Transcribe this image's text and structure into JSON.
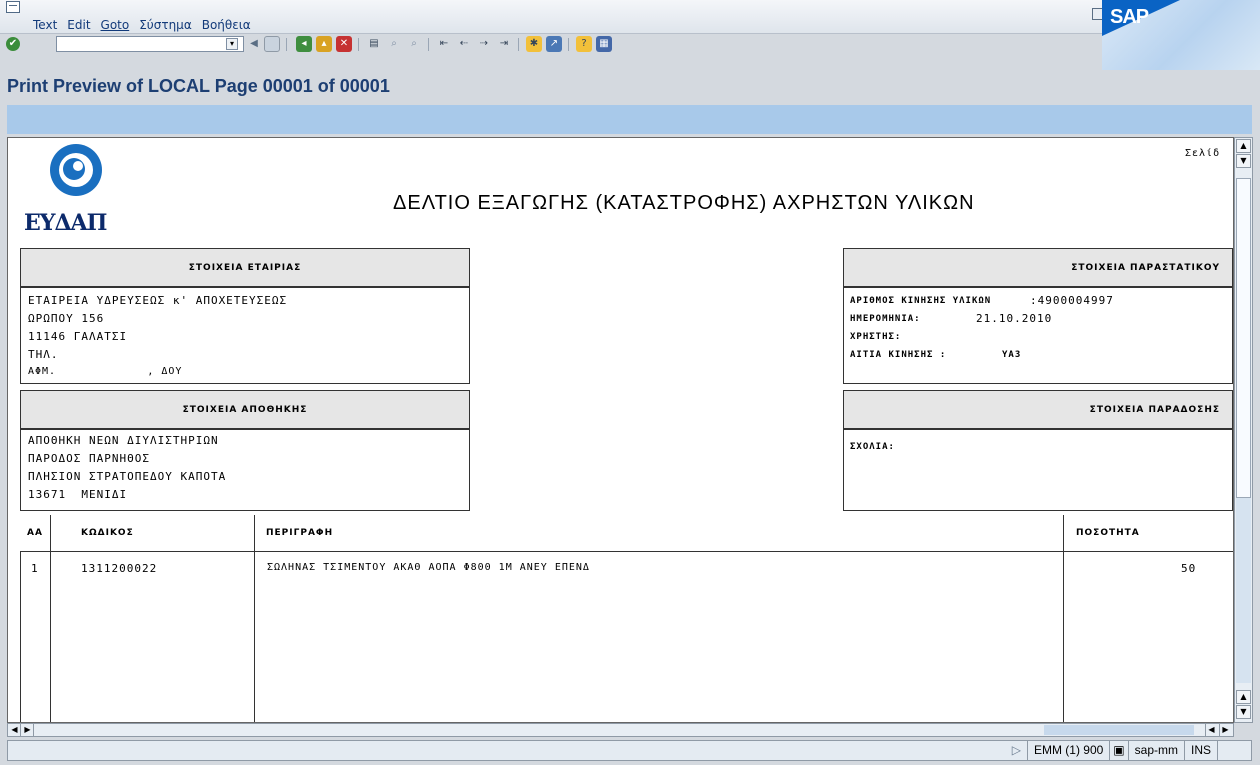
{
  "menu": [
    "Text",
    "Edit",
    "Goto",
    "Σύστημα",
    "Βοήθεια"
  ],
  "sap_logo": "SAP",
  "page_title": "Print Preview of LOCAL Page 00001 of 00001",
  "doc": {
    "logo_text": "ΕΥΔΑΠ",
    "title": "ΔΕΛΤΙΟ ΕΞΑΓΩΓΗΣ (ΚΑΤΑΣΤΡΟΦΗΣ) ΑΧΡΗΣΤΩΝ ΥΛΙΚΩΝ",
    "page_label": "Σελίδ",
    "company_header": "ΣΤΟΙΧΕΙΑ ΕΤΑΙΡΙΑΣ",
    "company_lines": [
      "ΕΤΑΙΡΕΙΑ ΥΔΡΕΥΣΕΩΣ κ' ΑΠΟΧΕΤΕΥΣΕΩΣ",
      "ΩΡΩΠΟΥ 156",
      "11146 ΓΑΛΑΤΣΙ",
      "ΤΗΛ.",
      "ΑΦΜ.             , ΔΟΥ"
    ],
    "doc_header": "ΣΤΟΙΧΕΙΑ ΠΑΡΑΣΤΑΤΙΚΟΥ",
    "doc_lines": [
      {
        "label": "ΑΡΙΘΜΟΣ ΚΙΝΗΣΗΣ ΥΛΙΚΩΝ",
        "value": ":4900004997"
      },
      {
        "label": "ΗΜΕΡΟΜΗΝΙΑ:",
        "value": "21.10.2010"
      },
      {
        "label": "ΧΡΗΣΤΗΣ:",
        "value": ""
      },
      {
        "label": "ΑΙΤΙΑ ΚΙΝΗΣΗΣ :",
        "value": "ΥΑ3"
      }
    ],
    "warehouse_header": "ΣΤΟΙΧΕΙΑ ΑΠΟΘΗΚΗΣ",
    "warehouse_lines": [
      "ΑΠΟΘΗΚΗ ΝΕΩΝ ΔΙΥΛΙΣΤΗΡΙΩΝ",
      "ΠΑΡΟΔΟΣ ΠΑΡΝΗΘΟΣ",
      "ΠΛΗΣΙΟΝ ΣΤΡΑΤΟΠΕΔΟΥ ΚΑΠΟΤΑ",
      "13671  ΜΕΝΙΔΙ"
    ],
    "delivery_header": "ΣΤΟΙΧΕΙΑ ΠΑΡΑΔΟΣΗΣ",
    "comments_label": "ΣΧΟΛΙΑ:",
    "columns": [
      "ΑΑ",
      "ΚΩΔΙΚΟΣ",
      "ΠΕΡΙΓΡΑΦΗ",
      "ΠΟΣΟΤΗΤΑ"
    ],
    "rows": [
      {
        "aa": "1",
        "code": "1311200022",
        "desc": "ΣΩΛΗΝΑΣ ΤΣΙΜΕΝΤΟΥ ΑΚΑΘ ΑΟΠΑ Φ800 1Μ ΑΝΕΥ ΕΠΕΝΔ",
        "qty": "50"
      }
    ]
  },
  "status": {
    "session": "EMM (1) 900",
    "user": "sap-mm",
    "mode": "INS"
  },
  "colors": {
    "sap_blue": "#0a63c4",
    "title_blue": "#1d3f73",
    "bar_blue": "#a8c9ea"
  },
  "icons": [
    "enter-icon",
    "back-icon",
    "save-icon",
    "exit-icon",
    "print-icon",
    "find-icon",
    "help-icon"
  ]
}
